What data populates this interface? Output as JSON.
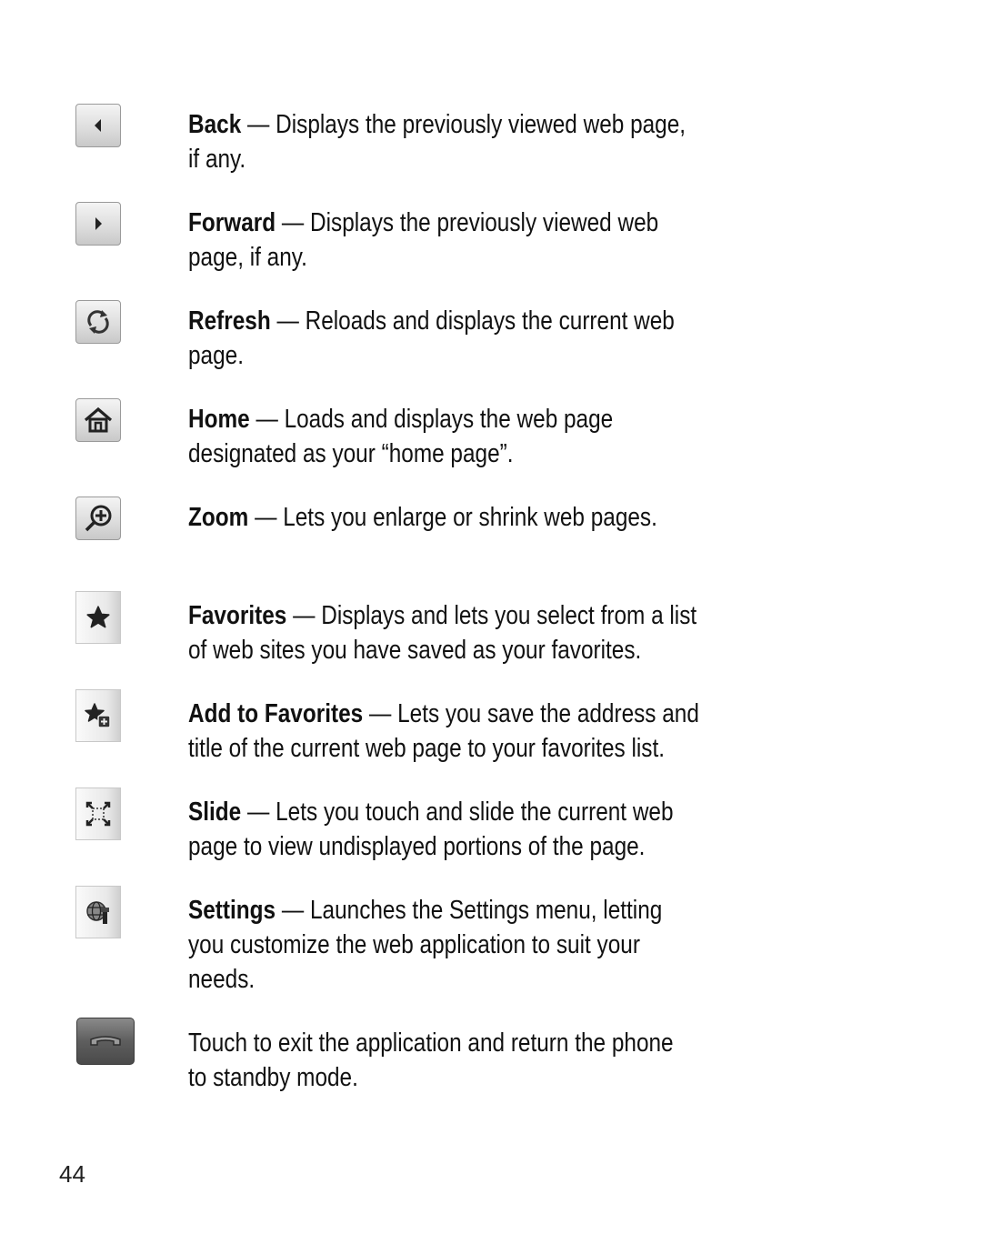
{
  "items": [
    {
      "icon": "back-arrow-icon",
      "term": "Back",
      "separator": " — ",
      "lines": [
        "Displays the previously viewed web page,",
        "if any."
      ]
    },
    {
      "icon": "forward-arrow-icon",
      "term": "Forward",
      "separator": " — ",
      "lines": [
        "Displays the previously viewed web",
        "page, if any."
      ]
    },
    {
      "icon": "refresh-icon",
      "term": "Refresh",
      "separator": " — ",
      "lines": [
        "Reloads and displays the current web",
        "page."
      ]
    },
    {
      "icon": "home-icon",
      "term": "Home",
      "separator": " — ",
      "lines": [
        "Loads and displays the web page",
        "designated as your “home page”."
      ]
    },
    {
      "icon": "zoom-in-icon",
      "term": "Zoom",
      "separator": " — ",
      "lines": [
        "Lets you enlarge or shrink web pages."
      ]
    },
    {
      "icon": "star-icon",
      "term": "Favorites",
      "separator": " — ",
      "lines": [
        "Displays and lets you select from a list",
        "of web sites you have saved as your favorites."
      ]
    },
    {
      "icon": "add-favorite-icon",
      "term": "Add to Favorites",
      "separator": " — ",
      "lines": [
        "Lets you save the address and",
        "title of the current web page to your favorites list."
      ]
    },
    {
      "icon": "slide-expand-icon",
      "term": "Slide",
      "separator": " — ",
      "lines": [
        "Lets you touch and slide the current web",
        "page to view undisplayed portions of the page."
      ]
    },
    {
      "icon": "settings-globe-icon",
      "term": "Settings",
      "separator": " — ",
      "lines": [
        "Launches the Settings menu, letting",
        "you customize the web application to suit your",
        "needs."
      ]
    },
    {
      "icon": "end-call-icon",
      "term": "",
      "separator": "",
      "lines": [
        "Touch to exit the application and return the phone",
        "to standby mode."
      ]
    }
  ],
  "page_number": "44"
}
